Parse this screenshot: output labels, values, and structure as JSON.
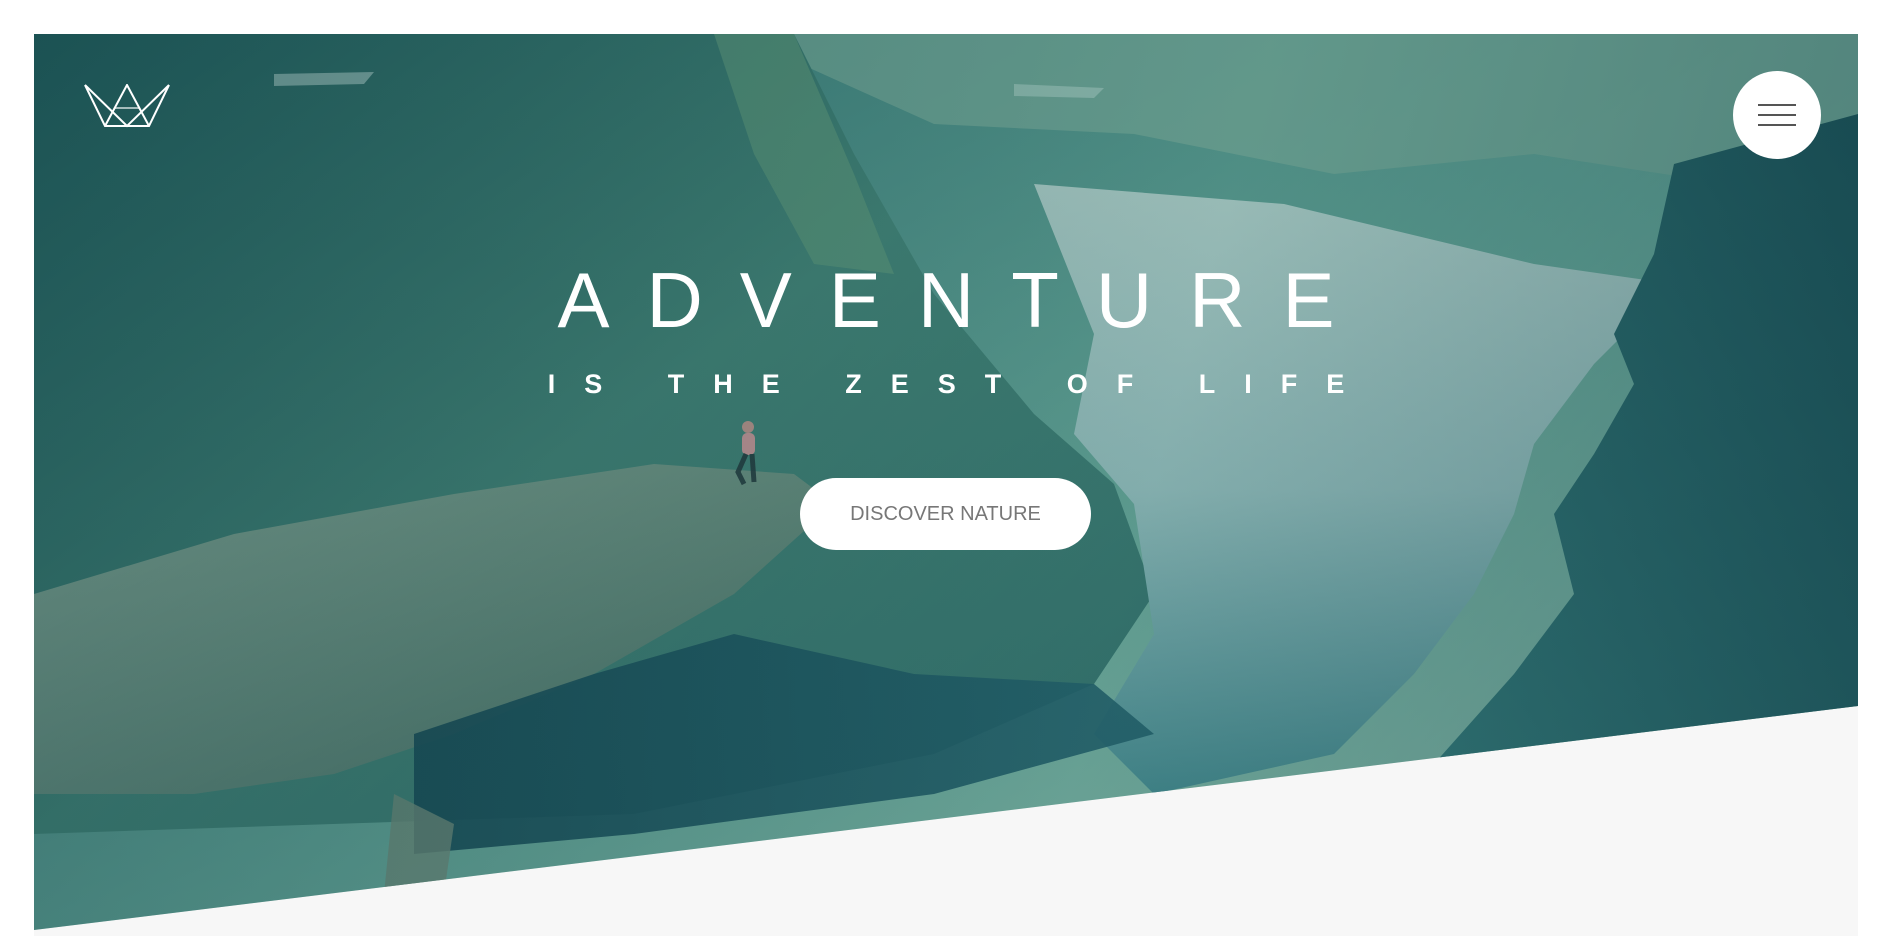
{
  "header": {
    "logo_icon": "crown-icon",
    "menu_icon": "hamburger-menu-icon"
  },
  "hero": {
    "title": "ADVENTURE",
    "subtitle": "IS THE ZEST OF LIFE",
    "cta_label": "DISCOVER NATURE"
  },
  "colors": {
    "overlay_teal": "#2c7a78",
    "text": "#ffffff",
    "button_bg": "#ffffff",
    "button_text": "#777777",
    "section_bg": "#f7f7f7"
  }
}
